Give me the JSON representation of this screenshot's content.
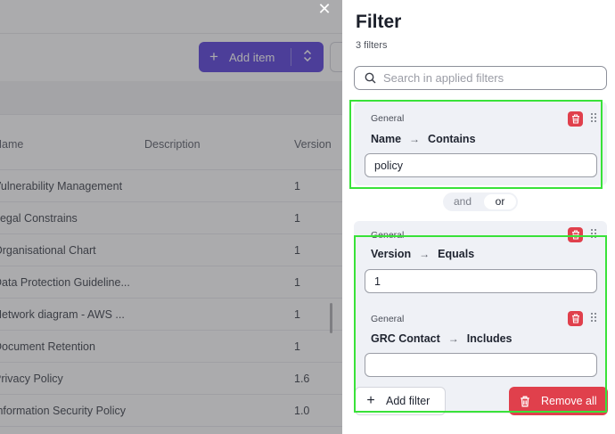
{
  "background": {
    "add_item_label": "Add item",
    "table": {
      "headers": {
        "name": "Name",
        "description": "Description",
        "version": "Version"
      },
      "rows": [
        {
          "name": "Vulnerability Management",
          "version": "1"
        },
        {
          "name": "Legal Constrains",
          "version": "1"
        },
        {
          "name": "Organisational Chart",
          "version": "1"
        },
        {
          "name": "Data Protection Guideline...",
          "version": "1"
        },
        {
          "name": "Network diagram - AWS ...",
          "version": "1"
        },
        {
          "name": "Document Retention",
          "version": "1"
        },
        {
          "name": "Privacy Policy",
          "version": "1.6"
        },
        {
          "name": "Information Security Policy",
          "version": "1.0"
        }
      ]
    }
  },
  "drawer": {
    "title": "Filter",
    "count": "3 filters",
    "search_placeholder": "Search in applied filters",
    "filters": [
      {
        "tag": "General",
        "field": "Name",
        "operator": "Contains",
        "value": "policy"
      },
      {
        "tag": "General",
        "field": "Version",
        "operator": "Equals",
        "value": "1"
      },
      {
        "tag": "General",
        "field": "GRC Contact",
        "operator": "Includes",
        "value": ""
      }
    ],
    "logic": {
      "and_label": "and",
      "or_label": "or",
      "selected": "or"
    },
    "add_filter_label": "Add filter",
    "remove_all_label": "Remove all"
  },
  "colors": {
    "primary": "#4a2fd8",
    "danger": "#e0404c",
    "highlight": "#39e239",
    "card": "#eff1f6"
  }
}
